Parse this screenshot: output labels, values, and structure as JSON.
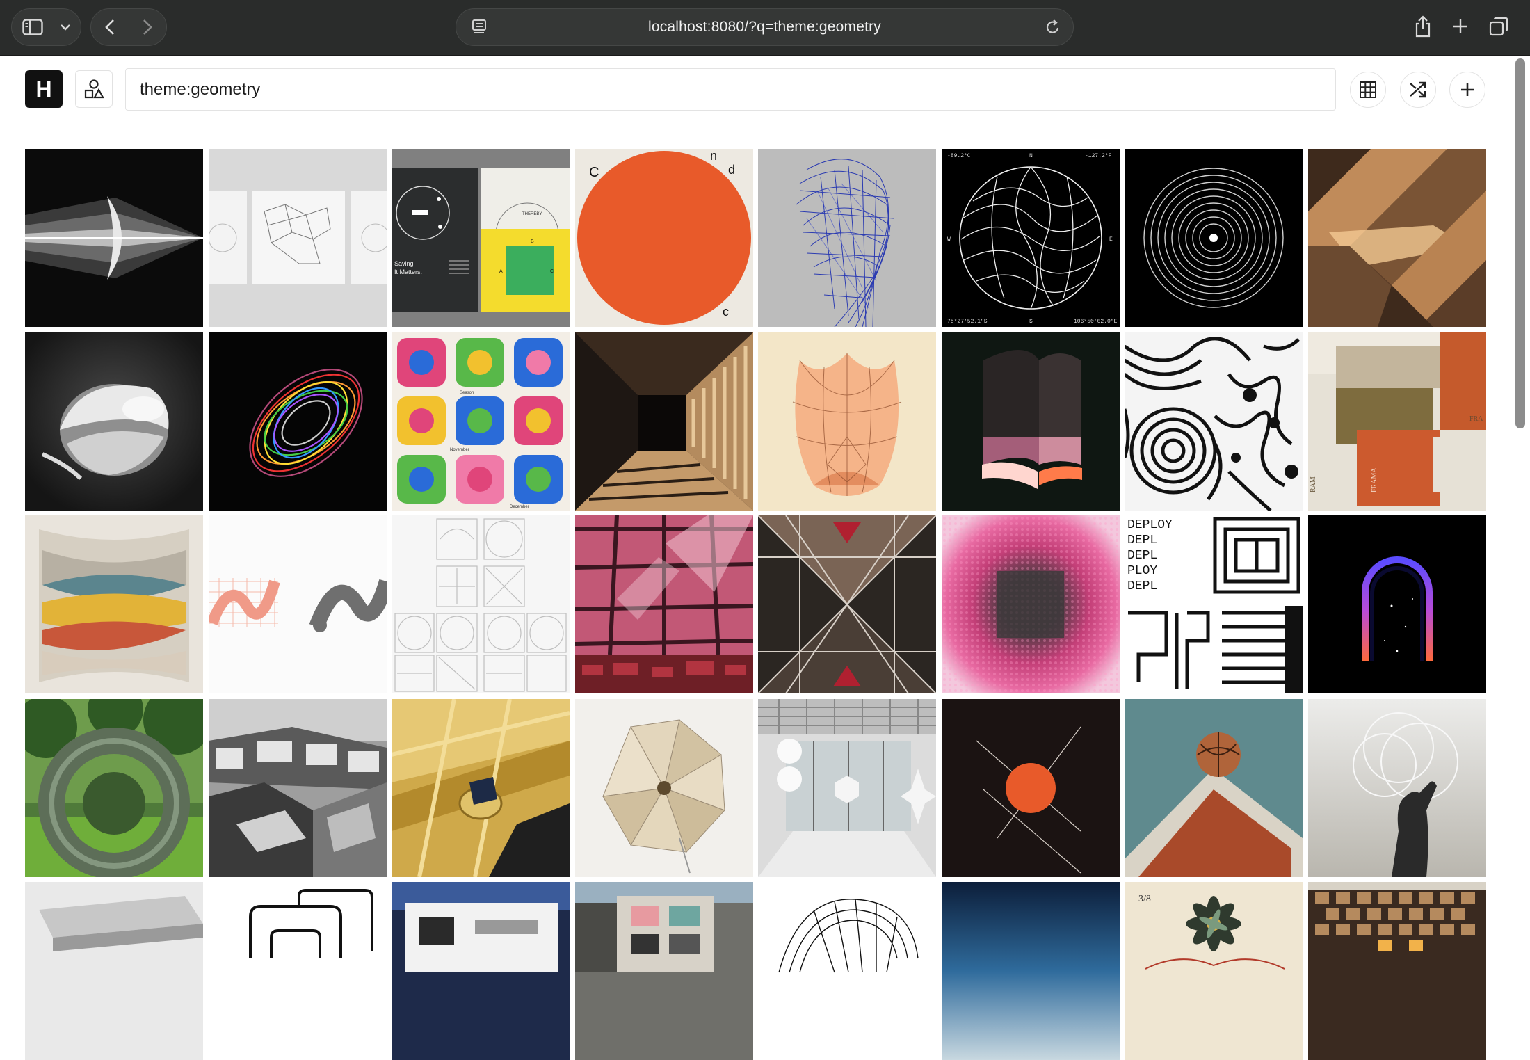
{
  "browser": {
    "url": "localhost:8080/?q=theme:geometry",
    "icons": [
      "sidebar-icon",
      "chevron-down-icon",
      "back-icon",
      "forward-icon",
      "reader-icon",
      "reload-icon",
      "share-icon",
      "new-tab-icon",
      "tabs-overview-icon"
    ]
  },
  "app": {
    "logo_letter": "H",
    "search": {
      "value": "theme:geometry",
      "placeholder": ""
    },
    "toolbar": [
      "grid-view-icon",
      "shuffle-icon",
      "add-icon"
    ]
  },
  "tiles": [
    {
      "id": "t1",
      "desc": "light-beam-lens"
    },
    {
      "id": "t2",
      "desc": "network-cards"
    },
    {
      "id": "t3",
      "desc": "circle-posters"
    },
    {
      "id": "t4",
      "desc": "orange-circle"
    },
    {
      "id": "t5",
      "desc": "blue-line-head"
    },
    {
      "id": "t6",
      "desc": "wire-globe"
    },
    {
      "id": "t7",
      "desc": "concentric-rings"
    },
    {
      "id": "t8",
      "desc": "wood-chevrons"
    },
    {
      "id": "t9",
      "desc": "white-sculpture"
    },
    {
      "id": "t10",
      "desc": "rainbow-orbits"
    },
    {
      "id": "t11",
      "desc": "pattern-calendar"
    },
    {
      "id": "t12",
      "desc": "corridor-shadows"
    },
    {
      "id": "t13",
      "desc": "orange-tulip"
    },
    {
      "id": "t14",
      "desc": "glowing-fold"
    },
    {
      "id": "t15",
      "desc": "maze-pattern"
    },
    {
      "id": "t16",
      "desc": "stacked-soap"
    },
    {
      "id": "t17",
      "desc": "layered-panels"
    },
    {
      "id": "t18",
      "desc": "letter-glyphs"
    },
    {
      "id": "t19",
      "desc": "glyph-grid"
    },
    {
      "id": "t20",
      "desc": "pink-ceiling"
    },
    {
      "id": "t21",
      "desc": "mirror-tunnel"
    },
    {
      "id": "t22",
      "desc": "pink-dither"
    },
    {
      "id": "t23",
      "desc": "deploy-typography"
    },
    {
      "id": "t24",
      "desc": "neon-arch"
    },
    {
      "id": "t25",
      "desc": "mirror-ring"
    },
    {
      "id": "t26",
      "desc": "concrete-building"
    },
    {
      "id": "t27",
      "desc": "gold-ring"
    },
    {
      "id": "t28",
      "desc": "paper-flower"
    },
    {
      "id": "t29",
      "desc": "glass-lobby"
    },
    {
      "id": "t30",
      "desc": "red-sun-lines"
    },
    {
      "id": "t31",
      "desc": "basketball-court"
    },
    {
      "id": "t32",
      "desc": "hand-circles"
    },
    {
      "id": "t33",
      "desc": "white-table"
    },
    {
      "id": "t34",
      "desc": "line-shapes"
    },
    {
      "id": "t35",
      "desc": "white-building"
    },
    {
      "id": "t36",
      "desc": "city-facade"
    },
    {
      "id": "t37",
      "desc": "wire-sculpture"
    },
    {
      "id": "t38",
      "desc": "night-sky"
    },
    {
      "id": "t39",
      "desc": "botanical-flower"
    },
    {
      "id": "t40",
      "desc": "brick-screen"
    }
  ],
  "poster_text": {
    "t3_a": "THEREBY",
    "t3_b": "Saving",
    "t3_c": "It Matters.",
    "t3_d": "B",
    "t3_e": "A",
    "t3_f": "C",
    "t4_a": "C",
    "t4_b": "n",
    "t4_c": "d",
    "t4_d": "c",
    "t6_a": "-89.2°C",
    "t6_b": "N",
    "t6_c": "-127.2°F",
    "t6_d": "W",
    "t6_e": "E",
    "t6_f": "78°27'52.1\"S",
    "t6_g": "S",
    "t6_h": "106°50'02.0\"E",
    "t11_a": "November",
    "t11_b": "December",
    "t11_c": "Season",
    "t16_a": "FRAMA",
    "t16_b": "FRA",
    "t16_c": "RAM",
    "t23_a": "DEPLOY",
    "t23_b": "DEPL",
    "t23_c": "PLOY",
    "t39_a": "3/8"
  }
}
